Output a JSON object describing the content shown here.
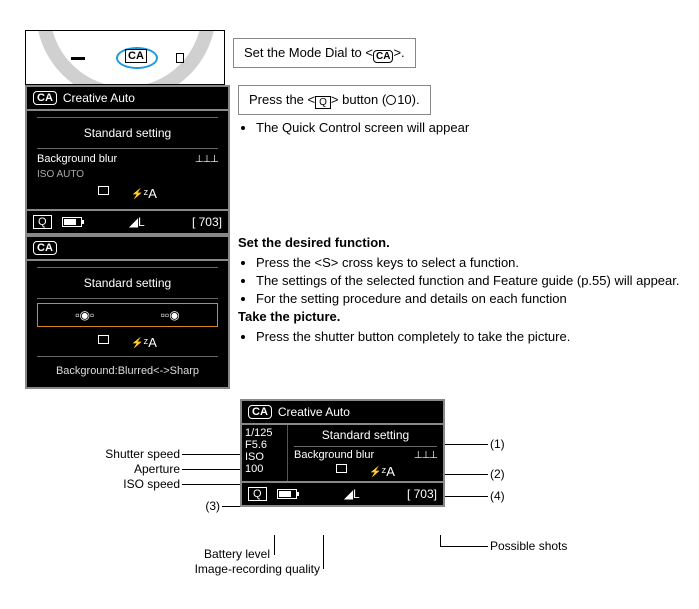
{
  "step1": {
    "instruction_prefix": "Set the Mode Dial to <",
    "instruction_suffix": ">.",
    "ca_label": "CA"
  },
  "step2": {
    "instruction_prefix": "Press the <",
    "instruction_mid": "> button (",
    "instruction_suffix": "10).",
    "q_label": "Q",
    "bullet1": "The Quick Control screen will appear"
  },
  "step3": {
    "heading": "Set the desired function.",
    "bullet1": "Press the <S> cross keys to select a function.",
    "bullet2": "The settings of the selected function and Feature guide (p.55) will appear.",
    "bullet3": "For the setting procedure and details on each function"
  },
  "step4": {
    "heading": "Take the picture.",
    "bullet1": "Press the shutter button completely to take the picture."
  },
  "screen1": {
    "ca": "CA",
    "title": "Creative Auto",
    "standard": "Standard setting",
    "bg_blur": "Background blur",
    "iso_auto": "ISO AUTO",
    "flash_auto": "ᶻA",
    "quality": "◢L",
    "shots": "[   703]",
    "q": "Q"
  },
  "screen2": {
    "ca": "CA",
    "standard": "Standard setting",
    "flash_auto": "ᶻA",
    "hint": "Background:Blurred<->Sharp"
  },
  "screen3": {
    "ca": "CA",
    "title": "Creative Auto",
    "shutter": "1/125",
    "aperture": "F5.6",
    "iso": "ISO 100",
    "standard": "Standard setting",
    "bg_blur": "Background blur",
    "flash_auto": "ᶻA",
    "quality": "◢L",
    "shots": "[   703]",
    "q": "Q"
  },
  "labels": {
    "shutter": "Shutter speed",
    "aperture": "Aperture",
    "iso": "ISO speed",
    "num3": "(3)",
    "battery": "Battery level",
    "quality": "Image-recording quality",
    "num1": "(1)",
    "num2": "(2)",
    "num4": "(4)",
    "shots": "Possible shots"
  }
}
